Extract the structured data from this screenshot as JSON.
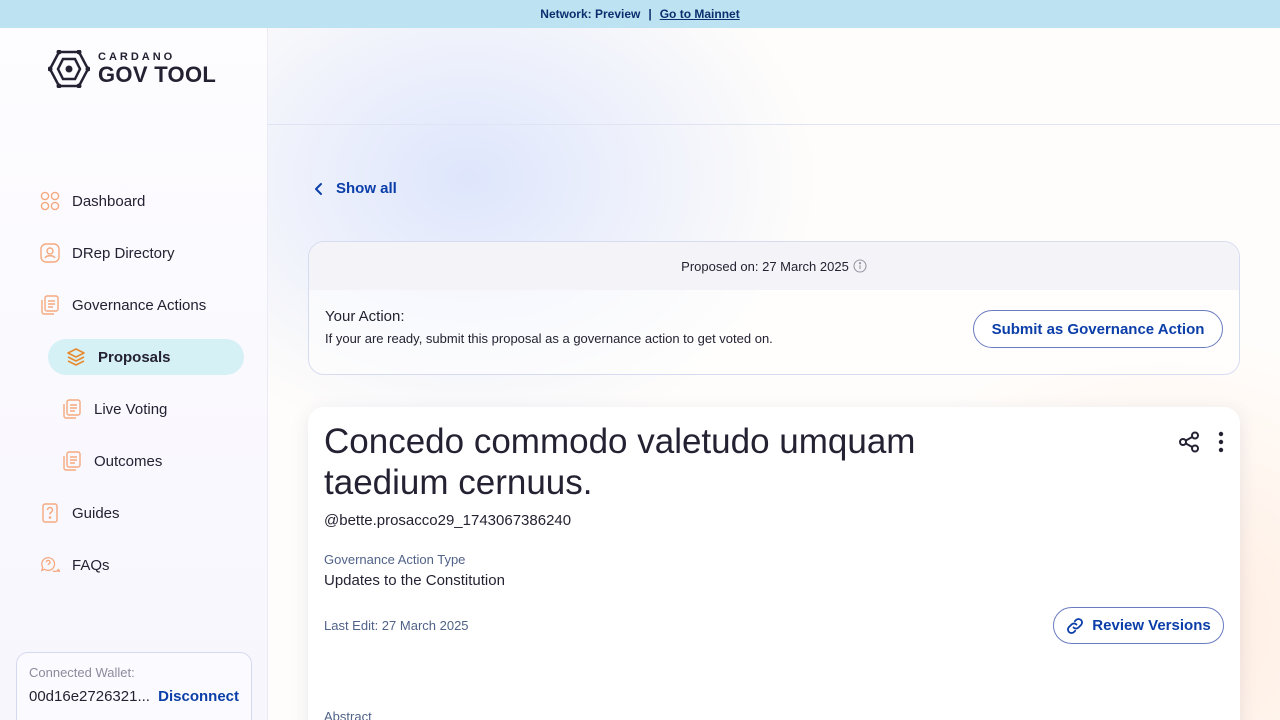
{
  "banner": {
    "network": "Network: Preview",
    "separator": "|",
    "link": "Go to Mainnet"
  },
  "logo": {
    "small": "CARDANO",
    "big": "GOV TOOL"
  },
  "nav": {
    "dashboard": "Dashboard",
    "drep_directory": "DRep Directory",
    "governance_actions": "Governance Actions",
    "proposals": "Proposals",
    "live_voting": "Live Voting",
    "outcomes": "Outcomes",
    "guides": "Guides",
    "faqs": "FAQs"
  },
  "wallet": {
    "label": "Connected Wallet:",
    "address": "00d16e2726321...",
    "disconnect": "Disconnect"
  },
  "back": {
    "label": "Show all"
  },
  "action": {
    "proposed_on": "Proposed on: 27 March 2025",
    "title": "Your Action:",
    "description": "If your are ready, submit this proposal as a governance action to get voted on.",
    "submit_label": "Submit as Governance Action"
  },
  "proposal": {
    "title": "Concedo commodo valetudo umquam taedium cernuus.",
    "author": "@bette.prosacco29_1743067386240",
    "type_label": "Governance Action Type",
    "type_value": "Updates to the Constitution",
    "last_edit": "Last Edit: 27 March 2025",
    "review_label": "Review Versions",
    "abstract_label": "Abstract"
  },
  "colors": {
    "accent_blue": "#0b3ea8",
    "banner_bg": "#bde3f2",
    "active_nav_bg": "#d6f1f6",
    "icon_orange": "#f5a97f"
  }
}
